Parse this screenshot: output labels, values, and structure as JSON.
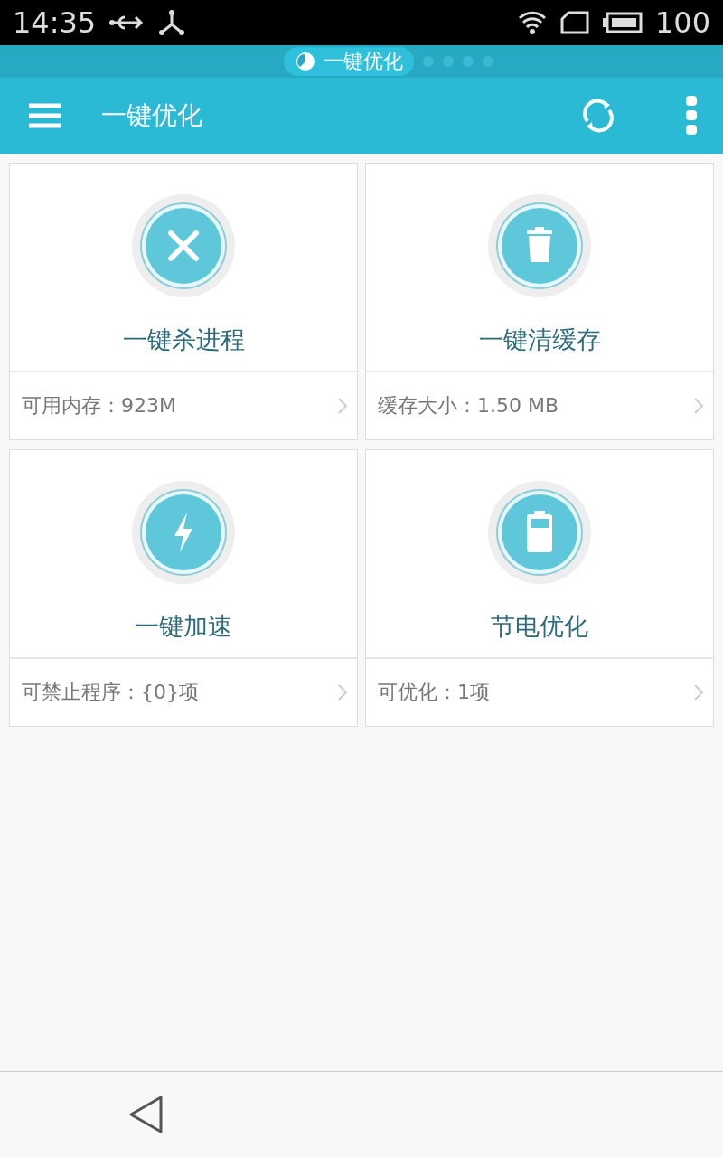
{
  "status_bar": {
    "time": "14:35",
    "battery": "100"
  },
  "pager": [
    {
      "label": "一键优化",
      "selected": true
    },
    {
      "selected": false
    },
    {
      "selected": false
    },
    {
      "selected": false
    },
    {
      "selected": false
    }
  ],
  "app_bar": {
    "title": "一键优化"
  },
  "cards": [
    {
      "kind": "close",
      "title": "一键杀进程",
      "detail": "可用内存：923M"
    },
    {
      "kind": "trash",
      "title": "一键清缓存",
      "detail": "缓存大小：1.50 MB"
    },
    {
      "kind": "bolt",
      "title": "一键加速",
      "detail": "可禁止程序：{0}项"
    },
    {
      "kind": "battery",
      "title": "节电优化",
      "detail": "可优化：1项"
    }
  ]
}
